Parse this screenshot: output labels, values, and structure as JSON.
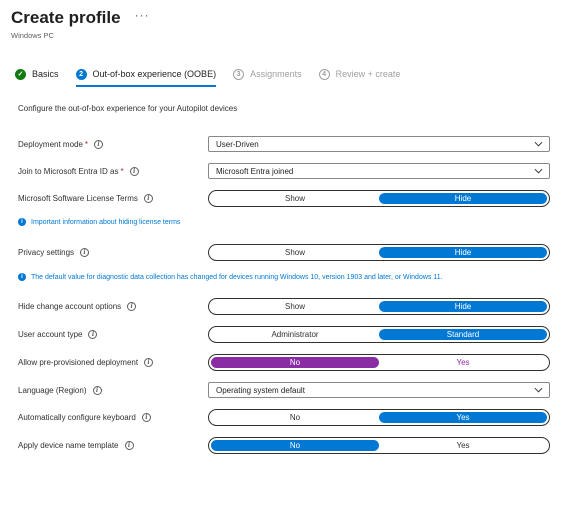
{
  "header": {
    "title": "Create profile",
    "subtitle": "Windows PC",
    "more_label": "···"
  },
  "steps": [
    {
      "number": "✓",
      "label": "Basics",
      "state": "done"
    },
    {
      "number": "2",
      "label": "Out-of-box experience (OOBE)",
      "state": "active"
    },
    {
      "number": "3",
      "label": "Assignments",
      "state": "pending"
    },
    {
      "number": "4",
      "label": "Review + create",
      "state": "pending"
    }
  ],
  "intro": "Configure the out-of-box experience for your Autopilot devices",
  "fields": {
    "deployment_mode": {
      "label": "Deployment mode",
      "required": "*",
      "value": "User-Driven"
    },
    "join_entra": {
      "label": "Join to Microsoft Entra ID as",
      "required": "*",
      "value": "Microsoft Entra joined"
    },
    "license_terms": {
      "label": "Microsoft Software License Terms",
      "option_a": "Show",
      "option_b": "Hide",
      "selected": "Hide"
    },
    "license_info": "Important information about hiding license terms",
    "privacy": {
      "label": "Privacy settings",
      "option_a": "Show",
      "option_b": "Hide",
      "selected": "Hide"
    },
    "privacy_info": "The default value for diagnostic data collection has changed for devices running Windows 10, version 1903 and later, or Windows 11.",
    "hide_change_account": {
      "label": "Hide change account options",
      "option_a": "Show",
      "option_b": "Hide",
      "selected": "Hide"
    },
    "user_account_type": {
      "label": "User account type",
      "option_a": "Administrator",
      "option_b": "Standard",
      "selected": "Standard"
    },
    "pre_provisioned": {
      "label": "Allow pre-provisioned deployment",
      "option_a": "No",
      "option_b": "Yes",
      "selected": "No"
    },
    "language": {
      "label": "Language (Region)",
      "value": "Operating system default"
    },
    "auto_keyboard": {
      "label": "Automatically configure keyboard",
      "option_a": "No",
      "option_b": "Yes",
      "selected": "Yes"
    },
    "device_name_template": {
      "label": "Apply device name template",
      "option_a": "No",
      "option_b": "Yes",
      "selected": "No"
    }
  },
  "colors": {
    "accent": "#0078d4",
    "purple": "#8a2da5",
    "success": "#107c10",
    "required": "#a4262c"
  },
  "icons": {
    "info": "info-icon",
    "chevron": "chevron-down-icon",
    "check": "check-icon"
  }
}
